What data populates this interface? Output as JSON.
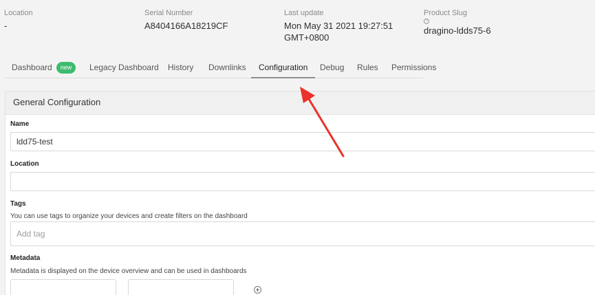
{
  "info": {
    "location": {
      "label": "Location",
      "value": "-"
    },
    "serial": {
      "label": "Serial Number",
      "value": "A8404166A18219CF"
    },
    "last_update": {
      "label": "Last update",
      "value_line1": "Mon May 31 2021 19:27:51",
      "value_line2": "GMT+0800"
    },
    "product_slug": {
      "label": "Product Slug",
      "value": "dragino-ldds75-6"
    }
  },
  "tabs": [
    {
      "label": "Dashboard",
      "badge": "new"
    },
    {
      "label": "Legacy Dashboard"
    },
    {
      "label": "History"
    },
    {
      "label": "Downlinks"
    },
    {
      "label": "Configuration",
      "active": true
    },
    {
      "label": "Debug"
    },
    {
      "label": "Rules"
    },
    {
      "label": "Permissions"
    }
  ],
  "card": {
    "title": "General Configuration",
    "name": {
      "label": "Name",
      "value": "ldd75-test"
    },
    "location": {
      "label": "Location",
      "value": ""
    },
    "tags": {
      "label": "Tags",
      "help": "You can use tags to organize your devices and create filters on the dashboard",
      "placeholder": "Add tag"
    },
    "metadata": {
      "label": "Metadata",
      "help": "Metadata is displayed on the device overview and can be used in dashboards"
    }
  },
  "annotation": {
    "color": "#e8322b"
  },
  "icons": {
    "product_slug_help": "question-circle-icon",
    "metadata_add": "plus-circle-icon"
  }
}
